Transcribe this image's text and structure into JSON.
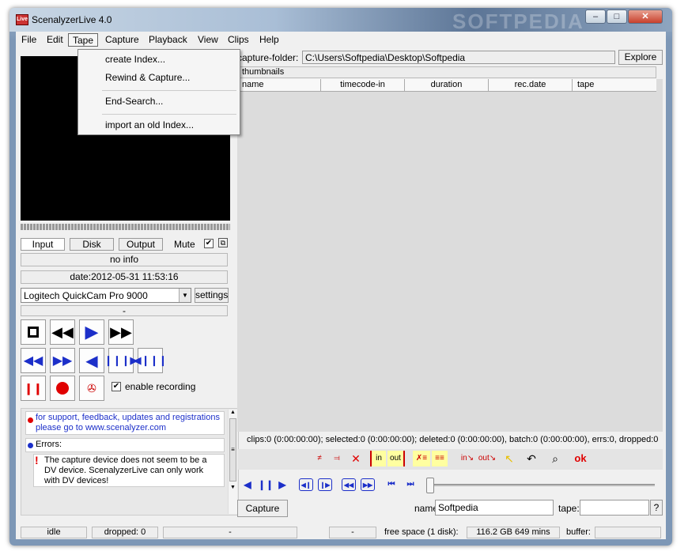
{
  "window": {
    "title": "ScenalyzerLive 4.0",
    "watermark": "SOFTPEDIA",
    "logo": "Live"
  },
  "menu": [
    "File",
    "Edit",
    "Tape",
    "Capture",
    "Playback",
    "View",
    "Clips",
    "Help"
  ],
  "tape_menu": {
    "items": [
      "create Index...",
      "Rewind & Capture...",
      "End-Search...",
      "import an old Index..."
    ]
  },
  "left": {
    "tabs": {
      "input": "Input",
      "disk": "Disk",
      "output": "Output",
      "mute": "Mute"
    },
    "info": "no info",
    "date": "date:2012-05-31 11:53:16",
    "device": "Logitech QuickCam Pro 9000",
    "settings": "settings",
    "dash": "-",
    "enable_recording": "enable recording",
    "support_line1": "for support, feedback, updates and registrations",
    "support_line2": "please go to www.scenalyzer.com",
    "errors_label": "Errors:",
    "error_text1": "The capture device does not seem to be a",
    "error_text2": "DV device. ScenalyzerLive can only work",
    "error_text3": "with DV devices!"
  },
  "right": {
    "capture_folder_label": "capture-folder:",
    "capture_folder_value": "C:\\Users\\Softpedia\\Desktop\\Softpedia",
    "explore": "Explore",
    "thumbnails": "thumbnails",
    "columns": [
      "name",
      "timecode-in",
      "duration",
      "rec.date",
      "tape"
    ],
    "clips_status": "clips:0 (0:00:00:00); selected:0 (0:00:00:00); deleted:0 (0:00:00:00), batch:0 (0:00:00:00), errs:0, dropped:0",
    "ok": "ok",
    "in_label": "in",
    "out_label": "out",
    "capture_btn": "Capture",
    "name_label": "name:",
    "name_value": "Softpedia",
    "tape_label": "tape:",
    "tape_value": "",
    "question": "?"
  },
  "statusbar": {
    "idle": "idle",
    "dropped": "dropped: 0",
    "dash1": "-",
    "dash2": "-",
    "free_space_label": "free space (1 disk):",
    "free_space_value": "116.2 GB 649 mins",
    "buffer_label": "buffer:"
  },
  "colors": {
    "accent_blue": "#1c2fc9",
    "record_red": "#e00000",
    "menu_bg": "#f0f0f0"
  }
}
